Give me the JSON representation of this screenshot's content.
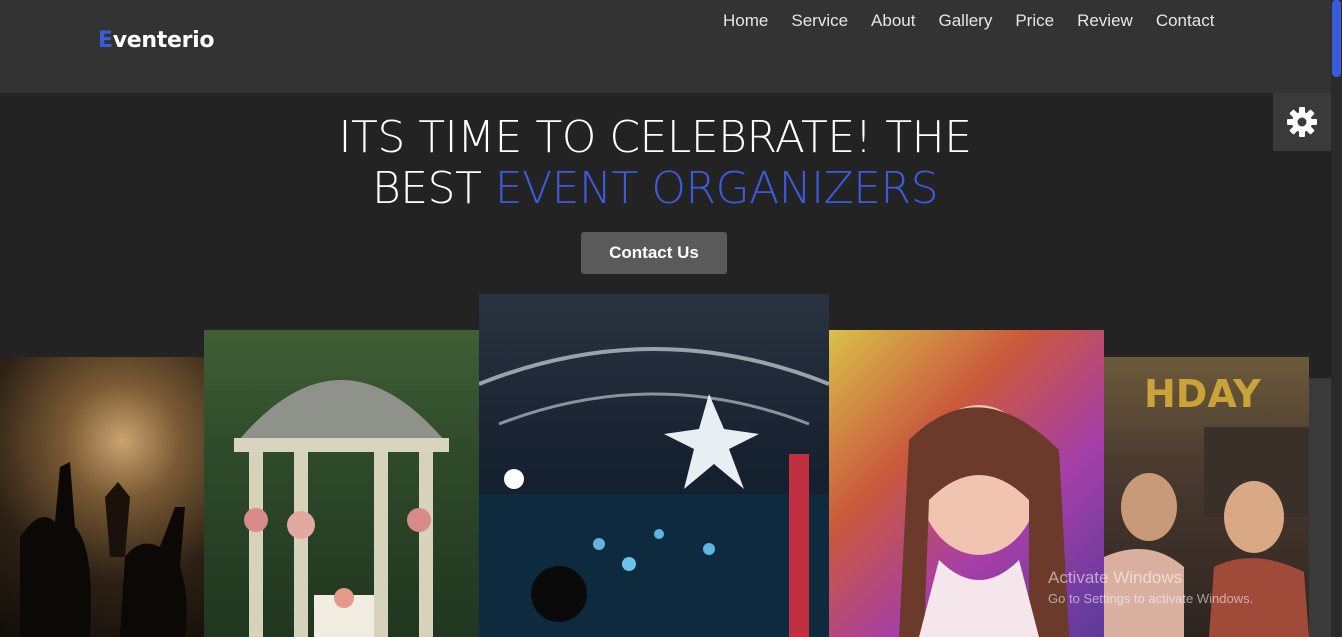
{
  "brand": {
    "logo_first_letter": "E",
    "logo_rest": "venterio",
    "accent_color": "#3b5bdb"
  },
  "nav": {
    "items": [
      "Home",
      "Service",
      "About",
      "Gallery",
      "Price",
      "Review",
      "Contact"
    ]
  },
  "hero": {
    "title_part1": "ITS TIME TO CELEBRATE! THE",
    "title_part2_prefix": "BEST ",
    "title_part2_highlight": "EVENT ORGANIZERS",
    "button_label": "Contact Us"
  },
  "settings": {
    "icon": "gear-icon"
  },
  "gallery": {
    "photos": [
      "concert-crowd-photo",
      "garden-gazebo-photo",
      "nightclub-party-photo",
      "color-powder-girl-photo",
      "birthday-party-photo",
      "partial-photo"
    ]
  },
  "watermark": {
    "line1": "Activate Windows",
    "line2": "Go to Settings to activate Windows."
  }
}
